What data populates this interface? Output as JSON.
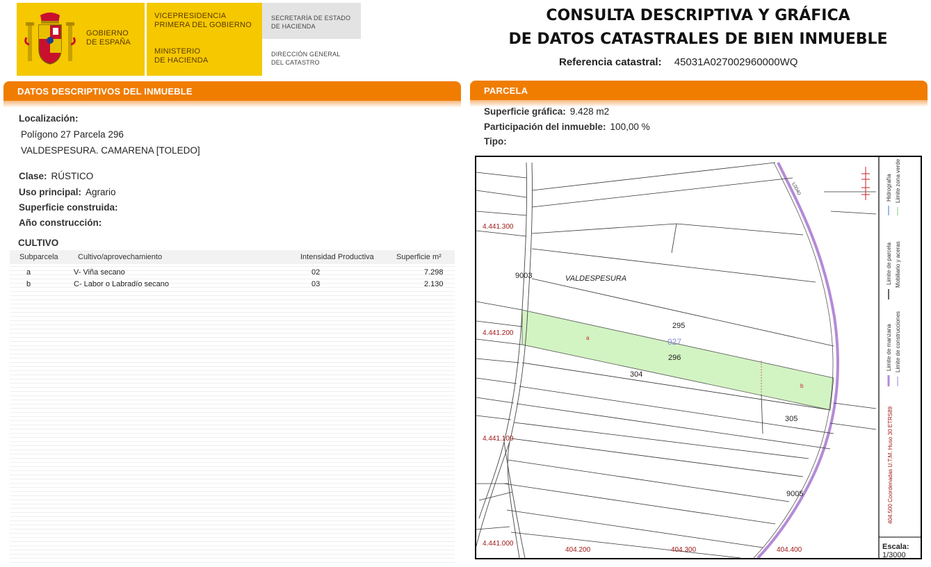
{
  "header": {
    "logo_gobierno": [
      "GOBIERNO",
      "DE ESPAÑA"
    ],
    "logo_vice": [
      "VICEPRESIDENCIA",
      "PRIMERA DEL GOBIERNO"
    ],
    "logo_ministerio": [
      "MINISTERIO",
      "DE HACIENDA"
    ],
    "secretaria": [
      "SECRETARÍA DE ESTADO",
      "DE HACIENDA"
    ],
    "direccion": [
      "DIRECCIÓN GENERAL",
      "DEL CATASTRO"
    ],
    "title_line1": "CONSULTA DESCRIPTIVA Y GRÁFICA",
    "title_line2": "DE DATOS CATASTRALES DE BIEN INMUEBLE",
    "ref_label": "Referencia catastral:",
    "ref_value": "45031A027002960000WQ"
  },
  "left": {
    "section_title": "DATOS DESCRIPTIVOS DEL INMUEBLE",
    "localizacion_label": "Localización:",
    "localizacion_line1": "Polígono 27 Parcela 296",
    "localizacion_line2": "VALDESPESURA. CAMARENA [TOLEDO]",
    "clase_label": "Clase:",
    "clase_value": "RÚSTICO",
    "uso_label": "Uso principal:",
    "uso_value": "Agrario",
    "superficie_label": "Superficie construida:",
    "anio_label": "Año construcción:",
    "cultivo_title": "CULTIVO",
    "cultivo_headers": [
      "Subparcela",
      "Cultivo/aprovechamiento",
      "Intensidad Productiva",
      "Superficie m²"
    ],
    "cultivo_rows": [
      {
        "sub": "a",
        "cultivo": "V- Viña secano",
        "intensidad": "02",
        "superficie": "7.298"
      },
      {
        "sub": "b",
        "cultivo": "C- Labor o Labradío secano",
        "intensidad": "03",
        "superficie": "2.130"
      }
    ]
  },
  "right": {
    "section_title": "PARCELA",
    "superficie_label": "Superficie gráfica:",
    "superficie_value": "9.428 m2",
    "participacion_label": "Participación del inmueble:",
    "participacion_value": "100,00 %",
    "tipo_label": "Tipo:"
  },
  "map": {
    "coord_y": [
      "4.441.300",
      "4.441.200",
      "4.441.100",
      "4.441.000"
    ],
    "coord_x": [
      "404.200",
      "404.300",
      "404.400"
    ],
    "paraje": "VALDESPESURA",
    "parcel_labels": [
      "9003",
      "295",
      "027",
      "296",
      "304",
      "305",
      "9005"
    ],
    "subparcel_labels": [
      "a",
      "b"
    ],
    "road_label": "L0040",
    "legend": {
      "col1": [
        "Limite de manzana",
        "Limite de parcela",
        "Hidrografía"
      ],
      "col2": [
        "Limite de construcciones",
        "Mobiliario y aceras",
        "Limite zona verde"
      ],
      "coords_note": "404.500 Coordenadas U.T.M. Huso 30 ETRS89",
      "escala_label": "Escala:",
      "escala_value": "1/3000"
    },
    "colors": {
      "parcel_fill": "#d2f3c2",
      "road": "#b48ad6",
      "coord_text": "#a01818",
      "cadastral_number": "#8c8cd8"
    }
  }
}
